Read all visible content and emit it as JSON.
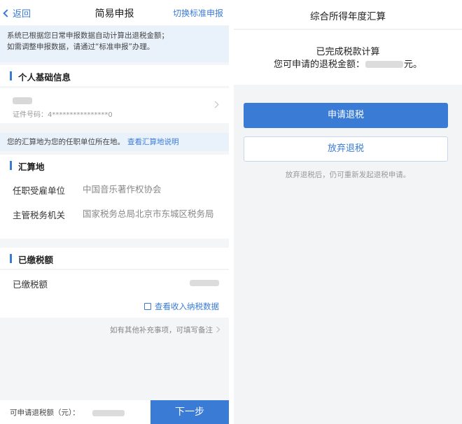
{
  "left": {
    "header": {
      "back_label": "返回",
      "title": "简易申报",
      "switch_label": "切换标准申报"
    },
    "notice": {
      "line1": "系统已根据您日常申报数据自动计算出退税金额；",
      "line2": "如需调整申报数据，请通过“标准申报”办理。"
    },
    "personal": {
      "title": "个人基础信息",
      "id_label": "证件号码：4****************0"
    },
    "tip": {
      "text": "您的汇算地为您的任职单位所在地。",
      "link": "查看汇算地说明"
    },
    "settlement": {
      "title": "汇算地",
      "employer_label": "任职受雇单位",
      "employer_value": "中国音乐著作权协会",
      "tax_office_label": "主管税务机关",
      "tax_office_value": "国家税务总局北京市东城区税务局"
    },
    "paid": {
      "title": "已缴税额",
      "label": "已缴税额"
    },
    "view_data_link": "查看收入纳税数据",
    "remark_link": "如有其他补充事项，可填写备注",
    "footer": {
      "refund_label": "可申请退税额（元）：",
      "next_button": "下一步"
    }
  },
  "right": {
    "header": {
      "title": "综合所得年度汇算"
    },
    "result": {
      "line1": "已完成税款计算",
      "line2": "您可申请的退税金额：",
      "unit_suffix": "元。"
    },
    "apply_button": "申请退税",
    "giveup_button": "放弃退税",
    "note": "放弃退税后，仍可重新发起退税申请。"
  }
}
